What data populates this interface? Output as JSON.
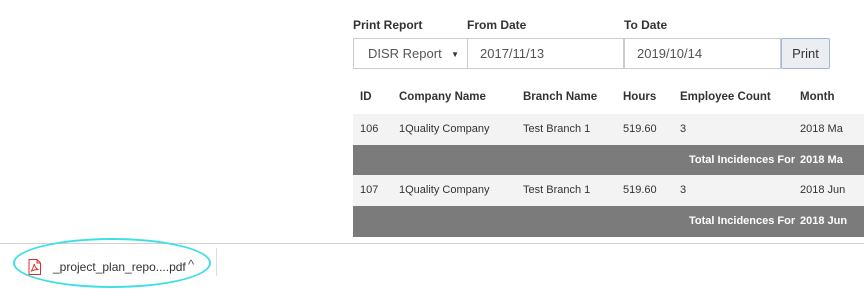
{
  "filters": {
    "print_report_label": "Print Report",
    "from_date_label": "From Date",
    "to_date_label": "To Date",
    "report_select_value": "DISR Report",
    "from_date_value": "2017/11/13",
    "to_date_value": "2019/10/14",
    "print_button": "Print"
  },
  "table": {
    "headers": [
      "ID",
      "Company Name",
      "Branch Name",
      "Hours",
      "Employee Count",
      "Month"
    ],
    "rows": [
      {
        "id": "106",
        "company": "1Quality Company",
        "branch": "Test Branch 1",
        "hours": "519.60",
        "employees": "3",
        "month": "2018 Ma"
      },
      {
        "id": "107",
        "company": "1Quality Company",
        "branch": "Test Branch 1",
        "hours": "519.60",
        "employees": "3",
        "month": "2018 Jun"
      }
    ],
    "totals": [
      {
        "label": "Total Incidences For",
        "month": "2018 Ma"
      },
      {
        "label": "Total Incidences For",
        "month": "2018 Jun"
      }
    ]
  },
  "downloads": {
    "file_name": "_project_plan_repo....pdf",
    "caret": "^"
  },
  "colors": {
    "total_row_bg": "#7b7b7b",
    "highlight_ring": "#3ee0e6",
    "pdf_icon": "#d9302c"
  }
}
